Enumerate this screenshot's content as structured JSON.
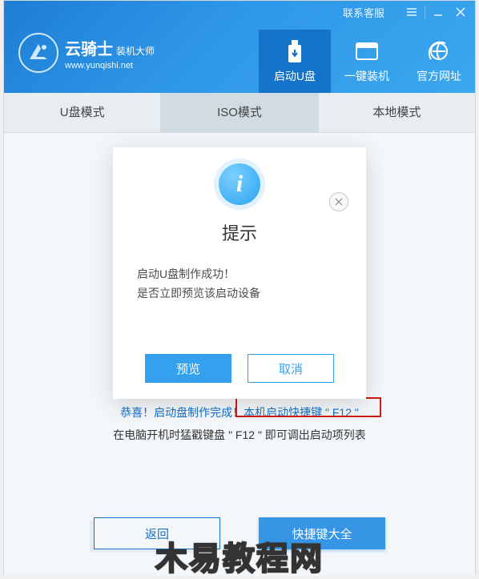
{
  "titlebar": {
    "contact": "联系客服"
  },
  "brand": {
    "name": "云骑士",
    "suffix": "装机大师",
    "url": "www.yunqishi.net"
  },
  "tabs": {
    "boot_usb": "启动U盘",
    "one_key": "一键装机",
    "official": "官方网址"
  },
  "subtabs": {
    "usb_mode": "U盘模式",
    "iso_mode": "ISO模式",
    "local_mode": "本地模式"
  },
  "success": {
    "line1a": "恭喜！启动盘制作完成！",
    "line1b": "本机启动快捷键 \" F12 \"",
    "line2": "在电脑开机时猛戳键盘 \" F12 \" 即可调出启动项列表"
  },
  "bottom": {
    "back": "返回",
    "hotkeys": "快捷键大全"
  },
  "dialog": {
    "title": "提示",
    "line1": "启动U盘制作成功！",
    "line2": "是否立即预览该启动设备",
    "preview": "预览",
    "cancel": "取消"
  },
  "watermark": "木易教程网"
}
